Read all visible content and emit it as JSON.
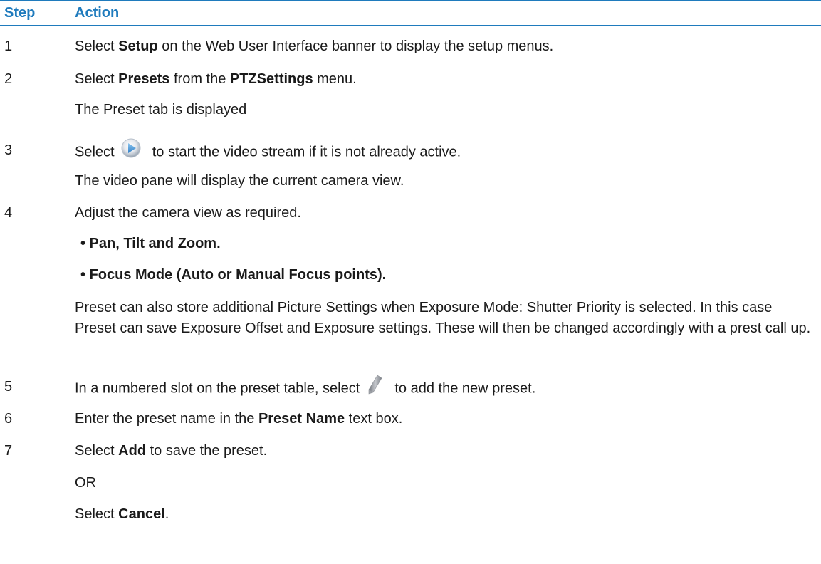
{
  "header": {
    "step": "Step",
    "action": "Action"
  },
  "s1": {
    "num": "1",
    "a": "Select ",
    "b": "Setup",
    "c": " on the Web User Interface banner to display the setup menus."
  },
  "s2": {
    "num": "2",
    "a": "Select ",
    "b": "Presets",
    "c": " from the ",
    "d": "PTZSettings",
    "e": " menu.",
    "note": "The Preset tab is displayed"
  },
  "s3": {
    "num": "3",
    "a": "Select ",
    "icon": "play-icon",
    "c": " to start the video stream if it is not already active.",
    "note": "The video pane will display the current camera view."
  },
  "s4": {
    "num": "4",
    "text": "Adjust the camera view as required.",
    "bullets": [
      "• Pan, Tilt and Zoom.",
      "• Focus Mode (Auto or Manual Focus points)."
    ],
    "para": "Preset can also store additional Picture Settings when Exposure Mode: Shutter Priority is selected. In this case Preset can save Exposure Offset and Exposure settings. These will then be changed accordingly with a prest call up."
  },
  "s5": {
    "num": "5",
    "a": "In a numbered slot on the preset table, select ",
    "icon": "pencil-icon",
    "c": " to add the new preset."
  },
  "s6": {
    "num": "6",
    "a": "Enter the preset name in the ",
    "b": "Preset Name",
    "c": " text box."
  },
  "s7": {
    "num": "7",
    "a": "Select ",
    "b": "Add",
    "c": " to save the preset.",
    "or": "OR",
    "d": "Select ",
    "e": "Cancel",
    "f": "."
  },
  "colors": {
    "accent": "#1f7bbd"
  }
}
